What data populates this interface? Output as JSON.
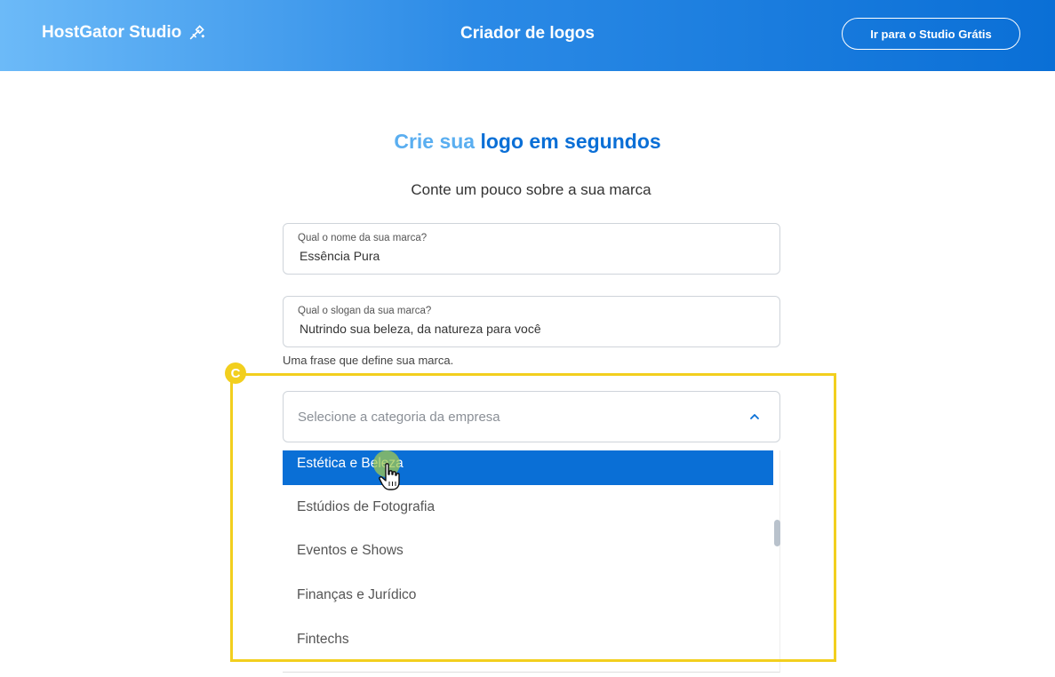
{
  "header": {
    "brand": "HostGator Studio",
    "title": "Criador de logos",
    "cta_button": "Ir para o Studio Grátis"
  },
  "hero": {
    "title_part1": "Crie sua ",
    "title_part2": "logo em segundos",
    "subtitle": "Conte um pouco sobre a sua marca"
  },
  "form": {
    "brand_name": {
      "label": "Qual o nome da sua marca?",
      "value": "Essência Pura"
    },
    "slogan": {
      "label": "Qual o slogan da sua marca?",
      "value": "Nutrindo sua beleza, da natureza para você",
      "helper": "Uma frase que define sua marca."
    },
    "category": {
      "placeholder": "Selecione a categoria da empresa",
      "options": [
        "Estética e Beleza",
        "Estúdios de Fotografia",
        "Eventos e Shows",
        "Finanças e Jurídico",
        "Fintechs"
      ],
      "highlighted": "Estética e Beleza"
    }
  },
  "annotation": {
    "badge_letter": "C",
    "color": "#f2cf1e"
  },
  "colors": {
    "primary": "#0a6fd6",
    "accent_light": "#5aaef0"
  },
  "icons": {
    "brand": "magic-wand-icon",
    "select": "chevron-up-icon",
    "cursor": "hand-pointer-icon"
  }
}
